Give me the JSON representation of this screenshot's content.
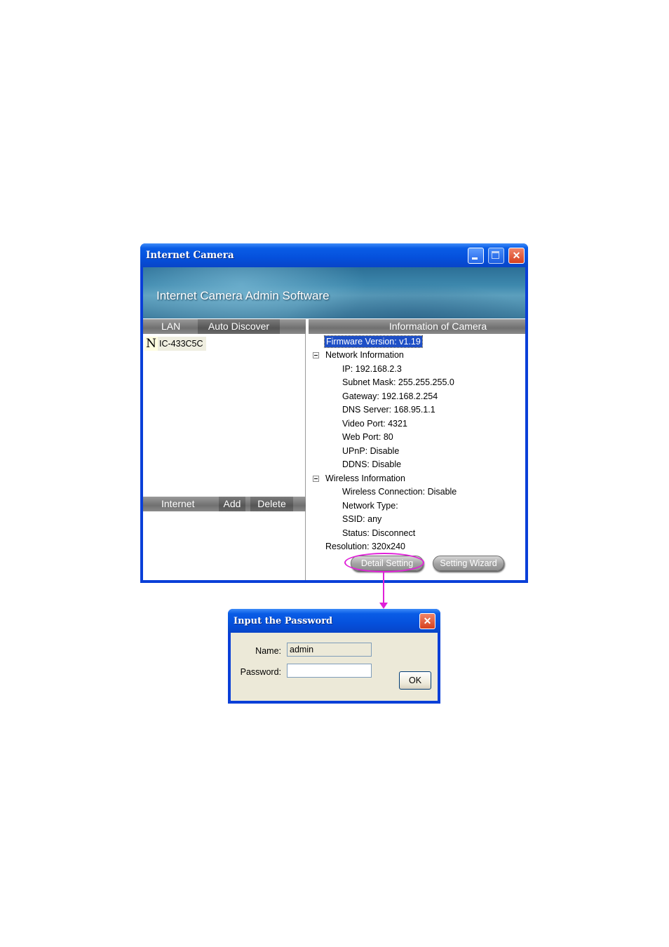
{
  "main_window": {
    "title": "Internet Camera",
    "banner_title": "Internet Camera Admin Software",
    "controls": {
      "minimize": "_",
      "maximize": "□",
      "close": "✕"
    }
  },
  "left_panel": {
    "header": {
      "lan": "LAN",
      "auto_discover": "Auto Discover"
    },
    "device": {
      "icon_letter": "N",
      "name": "IC-433C5C"
    },
    "internet_bar": {
      "internet": "Internet",
      "add": "Add",
      "delete": "Delete"
    }
  },
  "right_panel": {
    "header": "Information of Camera",
    "firmware": "Firmware Version: v1.19",
    "network_info": {
      "label": "Network Information",
      "ip": "IP:  192.168.2.3",
      "subnet_mask": "Subnet Mask:  255.255.255.0",
      "gateway": "Gateway:  192.168.2.254",
      "dns_server": "DNS Server:  168.95.1.1",
      "video_port": "Video Port:  4321",
      "web_port": "Web Port:  80",
      "upnp": "UPnP:  Disable",
      "ddns": "DDNS:  Disable"
    },
    "wireless_info": {
      "label": "Wireless Information",
      "connection": "Wireless Connection: Disable",
      "network_type": "Network Type:",
      "ssid": "SSID: any",
      "status": "Status: Disconnect"
    },
    "resolution": "Resolution: 320x240",
    "buttons": {
      "detail_setting": "Detail Setting",
      "setting_wizard": "Setting Wizard"
    },
    "highlight_color": "#e020d8"
  },
  "password_dialog": {
    "title": "Input the Password",
    "name_label": "Name:",
    "name_value": "admin",
    "password_label": "Password:",
    "password_value": "",
    "ok_label": "OK",
    "close": "✕"
  }
}
